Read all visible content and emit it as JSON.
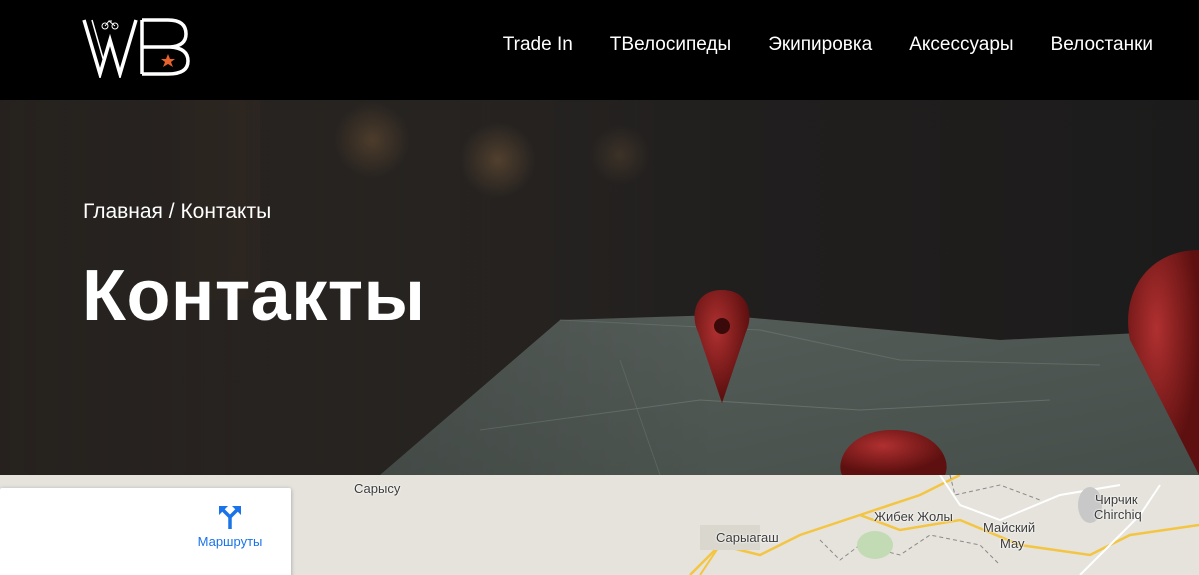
{
  "header": {
    "logo_text": "WB",
    "nav": [
      {
        "label": "Trade In"
      },
      {
        "label": "ТВелосипеды"
      },
      {
        "label": "Экипировка"
      },
      {
        "label": "Аксессуары"
      },
      {
        "label": "Велостанки"
      }
    ]
  },
  "hero": {
    "breadcrumb_home": "Главная",
    "breadcrumb_separator": " / ",
    "breadcrumb_current": "Контакты",
    "title": "Контакты"
  },
  "map": {
    "directions_label": "Маршруты",
    "places": [
      {
        "name": "Сарысу"
      },
      {
        "name": "Сарыагаш"
      },
      {
        "name": "Жибек Жолы"
      },
      {
        "name": "Майский"
      },
      {
        "name": "Мау"
      },
      {
        "name": "Чирчик"
      },
      {
        "name": "Chirchiq"
      }
    ]
  },
  "colors": {
    "header_bg": "#000000",
    "logo_star": "#e8622c",
    "pin_red": "#8b1c1c",
    "map_bg": "#e5e3dc",
    "directions_blue": "#1a73e8"
  }
}
